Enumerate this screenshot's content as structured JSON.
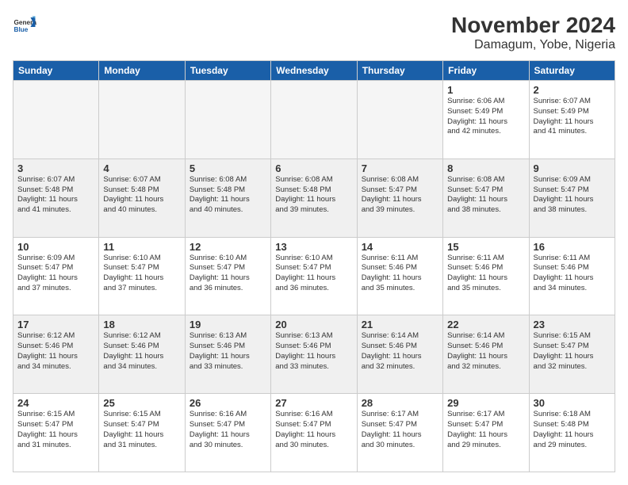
{
  "logo": {
    "general": "General",
    "blue": "Blue"
  },
  "header": {
    "month": "November 2024",
    "location": "Damagum, Yobe, Nigeria"
  },
  "days_of_week": [
    "Sunday",
    "Monday",
    "Tuesday",
    "Wednesday",
    "Thursday",
    "Friday",
    "Saturday"
  ],
  "weeks": [
    {
      "shaded": false,
      "days": [
        {
          "num": "",
          "info": ""
        },
        {
          "num": "",
          "info": ""
        },
        {
          "num": "",
          "info": ""
        },
        {
          "num": "",
          "info": ""
        },
        {
          "num": "",
          "info": ""
        },
        {
          "num": "1",
          "info": "Sunrise: 6:06 AM\nSunset: 5:49 PM\nDaylight: 11 hours\nand 42 minutes."
        },
        {
          "num": "2",
          "info": "Sunrise: 6:07 AM\nSunset: 5:49 PM\nDaylight: 11 hours\nand 41 minutes."
        }
      ]
    },
    {
      "shaded": true,
      "days": [
        {
          "num": "3",
          "info": "Sunrise: 6:07 AM\nSunset: 5:48 PM\nDaylight: 11 hours\nand 41 minutes."
        },
        {
          "num": "4",
          "info": "Sunrise: 6:07 AM\nSunset: 5:48 PM\nDaylight: 11 hours\nand 40 minutes."
        },
        {
          "num": "5",
          "info": "Sunrise: 6:08 AM\nSunset: 5:48 PM\nDaylight: 11 hours\nand 40 minutes."
        },
        {
          "num": "6",
          "info": "Sunrise: 6:08 AM\nSunset: 5:48 PM\nDaylight: 11 hours\nand 39 minutes."
        },
        {
          "num": "7",
          "info": "Sunrise: 6:08 AM\nSunset: 5:47 PM\nDaylight: 11 hours\nand 39 minutes."
        },
        {
          "num": "8",
          "info": "Sunrise: 6:08 AM\nSunset: 5:47 PM\nDaylight: 11 hours\nand 38 minutes."
        },
        {
          "num": "9",
          "info": "Sunrise: 6:09 AM\nSunset: 5:47 PM\nDaylight: 11 hours\nand 38 minutes."
        }
      ]
    },
    {
      "shaded": false,
      "days": [
        {
          "num": "10",
          "info": "Sunrise: 6:09 AM\nSunset: 5:47 PM\nDaylight: 11 hours\nand 37 minutes."
        },
        {
          "num": "11",
          "info": "Sunrise: 6:10 AM\nSunset: 5:47 PM\nDaylight: 11 hours\nand 37 minutes."
        },
        {
          "num": "12",
          "info": "Sunrise: 6:10 AM\nSunset: 5:47 PM\nDaylight: 11 hours\nand 36 minutes."
        },
        {
          "num": "13",
          "info": "Sunrise: 6:10 AM\nSunset: 5:47 PM\nDaylight: 11 hours\nand 36 minutes."
        },
        {
          "num": "14",
          "info": "Sunrise: 6:11 AM\nSunset: 5:46 PM\nDaylight: 11 hours\nand 35 minutes."
        },
        {
          "num": "15",
          "info": "Sunrise: 6:11 AM\nSunset: 5:46 PM\nDaylight: 11 hours\nand 35 minutes."
        },
        {
          "num": "16",
          "info": "Sunrise: 6:11 AM\nSunset: 5:46 PM\nDaylight: 11 hours\nand 34 minutes."
        }
      ]
    },
    {
      "shaded": true,
      "days": [
        {
          "num": "17",
          "info": "Sunrise: 6:12 AM\nSunset: 5:46 PM\nDaylight: 11 hours\nand 34 minutes."
        },
        {
          "num": "18",
          "info": "Sunrise: 6:12 AM\nSunset: 5:46 PM\nDaylight: 11 hours\nand 34 minutes."
        },
        {
          "num": "19",
          "info": "Sunrise: 6:13 AM\nSunset: 5:46 PM\nDaylight: 11 hours\nand 33 minutes."
        },
        {
          "num": "20",
          "info": "Sunrise: 6:13 AM\nSunset: 5:46 PM\nDaylight: 11 hours\nand 33 minutes."
        },
        {
          "num": "21",
          "info": "Sunrise: 6:14 AM\nSunset: 5:46 PM\nDaylight: 11 hours\nand 32 minutes."
        },
        {
          "num": "22",
          "info": "Sunrise: 6:14 AM\nSunset: 5:46 PM\nDaylight: 11 hours\nand 32 minutes."
        },
        {
          "num": "23",
          "info": "Sunrise: 6:15 AM\nSunset: 5:47 PM\nDaylight: 11 hours\nand 32 minutes."
        }
      ]
    },
    {
      "shaded": false,
      "days": [
        {
          "num": "24",
          "info": "Sunrise: 6:15 AM\nSunset: 5:47 PM\nDaylight: 11 hours\nand 31 minutes."
        },
        {
          "num": "25",
          "info": "Sunrise: 6:15 AM\nSunset: 5:47 PM\nDaylight: 11 hours\nand 31 minutes."
        },
        {
          "num": "26",
          "info": "Sunrise: 6:16 AM\nSunset: 5:47 PM\nDaylight: 11 hours\nand 30 minutes."
        },
        {
          "num": "27",
          "info": "Sunrise: 6:16 AM\nSunset: 5:47 PM\nDaylight: 11 hours\nand 30 minutes."
        },
        {
          "num": "28",
          "info": "Sunrise: 6:17 AM\nSunset: 5:47 PM\nDaylight: 11 hours\nand 30 minutes."
        },
        {
          "num": "29",
          "info": "Sunrise: 6:17 AM\nSunset: 5:47 PM\nDaylight: 11 hours\nand 29 minutes."
        },
        {
          "num": "30",
          "info": "Sunrise: 6:18 AM\nSunset: 5:48 PM\nDaylight: 11 hours\nand 29 minutes."
        }
      ]
    }
  ]
}
